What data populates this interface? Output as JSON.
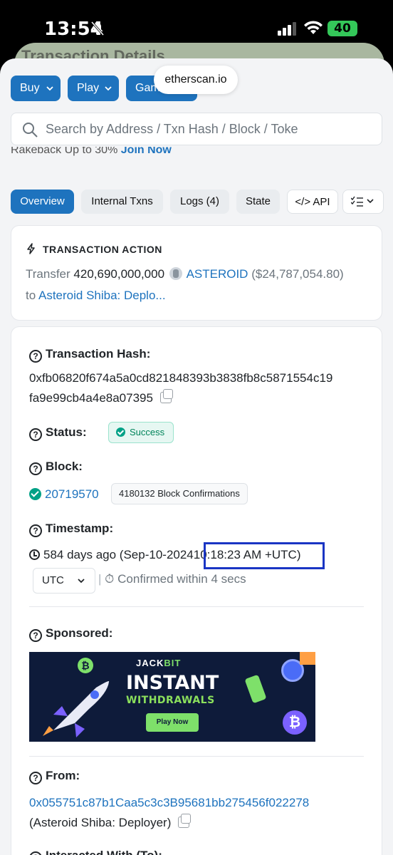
{
  "status_bar": {
    "time": "13:54",
    "battery": "40"
  },
  "browser": {
    "url": "etherscan.io",
    "ghost_title": "Transaction Details"
  },
  "top_buttons": [
    "Buy",
    "Play",
    "Gaming"
  ],
  "search": {
    "placeholder": "Search by Address / Txn Hash / Block / Toke"
  },
  "promo": {
    "text": "Rakeback Up to 30%",
    "link": "Join Now"
  },
  "tabs": [
    "Overview",
    "Internal Txns",
    "Logs (4)",
    "State",
    "API"
  ],
  "action": {
    "title": "TRANSACTION ACTION",
    "prefix": "Transfer",
    "amount": "420,690,000,000",
    "token": "ASTEROID",
    "usd": "($24,787,054.80)",
    "to_label": "to",
    "to_name": "Asteroid Shiba: Deplo..."
  },
  "details": {
    "hash_label": "Transaction Hash:",
    "hash_line1": "0xfb06820f674a5a0cd821848393b3838fb8c5871554c19",
    "hash_line2": "fa9e99cb4a4e8a07395",
    "status_label": "Status:",
    "status_value": "Success",
    "block_label": "Block:",
    "block_number": "20719570",
    "block_confirmations": "4180132 Block Confirmations",
    "timestamp_label": "Timestamp:",
    "timestamp_relative": "584 days ago (Sep-10-2024",
    "timestamp_time": "10:18:23 AM +UTC)",
    "timezone_select": "UTC",
    "confirmed_text": "Confirmed within 4 secs",
    "sponsored_label": "Sponsored:",
    "from_label": "From:",
    "from_address": "0x055751c87b1Caa5c3c3B95681bb275456f022278",
    "from_name": "(Asteroid Shiba: Deployer)",
    "interacted_label": "Interacted With (To):"
  },
  "ad": {
    "brand_a": "JACK",
    "brand_b": "BIT",
    "headline": "INSTANT",
    "subheadline": "WITHDRAWALS",
    "button": "Play Now",
    "colors": {
      "bg": "#0e1b3a",
      "accent": "#7ee06a"
    }
  },
  "colors": {
    "primary": "#1e73be",
    "success": "#00a186",
    "highlight_box": "#1a35c4"
  }
}
